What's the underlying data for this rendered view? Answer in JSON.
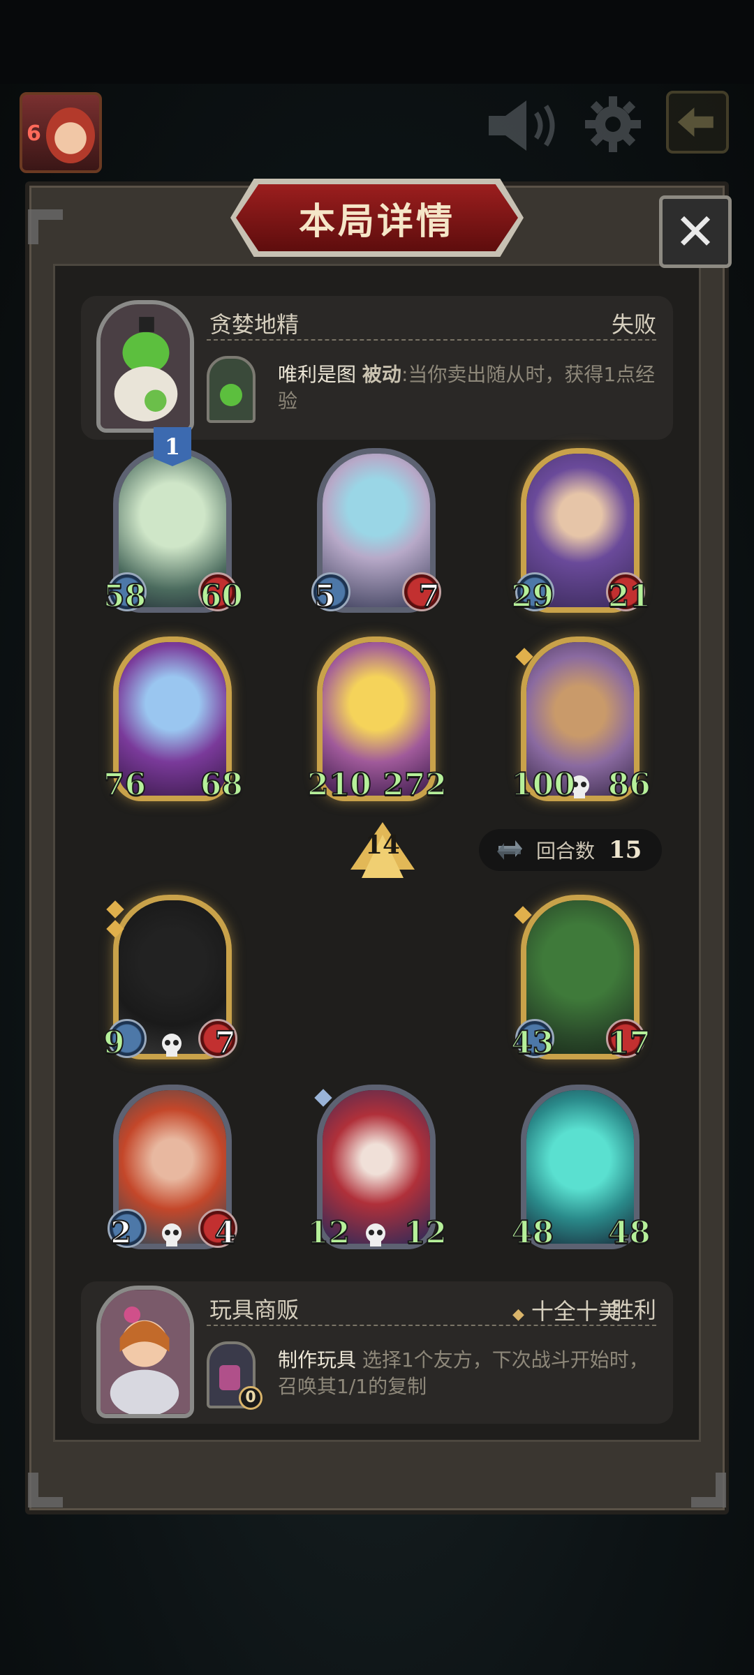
{
  "dialog": {
    "title": "本局详情",
    "close_glyph": "✕"
  },
  "top_bar": {
    "avatar_level": "6",
    "icons": [
      "speaker-icon",
      "gear-icon",
      "exit-icon"
    ]
  },
  "opponent": {
    "name": "贪婪地精",
    "result": "失败",
    "skill_name": "唯利是图",
    "skill_keyword": "被动",
    "skill_desc": ":当你卖出随从时，获得1点经验"
  },
  "player": {
    "name": "玩具商贩",
    "badge": "十全十美",
    "result": "胜利",
    "skill_name": "制作玩具",
    "skill_desc": "选择1个友方，下次战斗开始时，召唤其1/1的复制",
    "skill_charges": "0"
  },
  "opponent_board": [
    {
      "atk": "58",
      "hp": "60",
      "tier": "1"
    },
    {
      "atk": "5",
      "hp": "7"
    },
    {
      "atk": "29",
      "hp": "21"
    },
    {
      "atk": "76",
      "hp": "68"
    },
    {
      "atk": "210",
      "hp": "272"
    },
    {
      "atk": "100",
      "hp": "86"
    }
  ],
  "player_board": [
    {
      "atk": "9",
      "hp": "7"
    },
    {
      "atk": "43",
      "hp": "17"
    },
    {
      "atk": "2",
      "hp": "4"
    },
    {
      "atk": "12",
      "hp": "12"
    },
    {
      "atk": "48",
      "hp": "48"
    }
  ],
  "turn": {
    "label": "回合数",
    "value": "15"
  },
  "player_level": "14",
  "colors": {
    "panel": "#3a3630",
    "title_red": "#9b1e1e",
    "gold_frame": "#c9a24a",
    "buffed_stat": "#b6f09a"
  }
}
